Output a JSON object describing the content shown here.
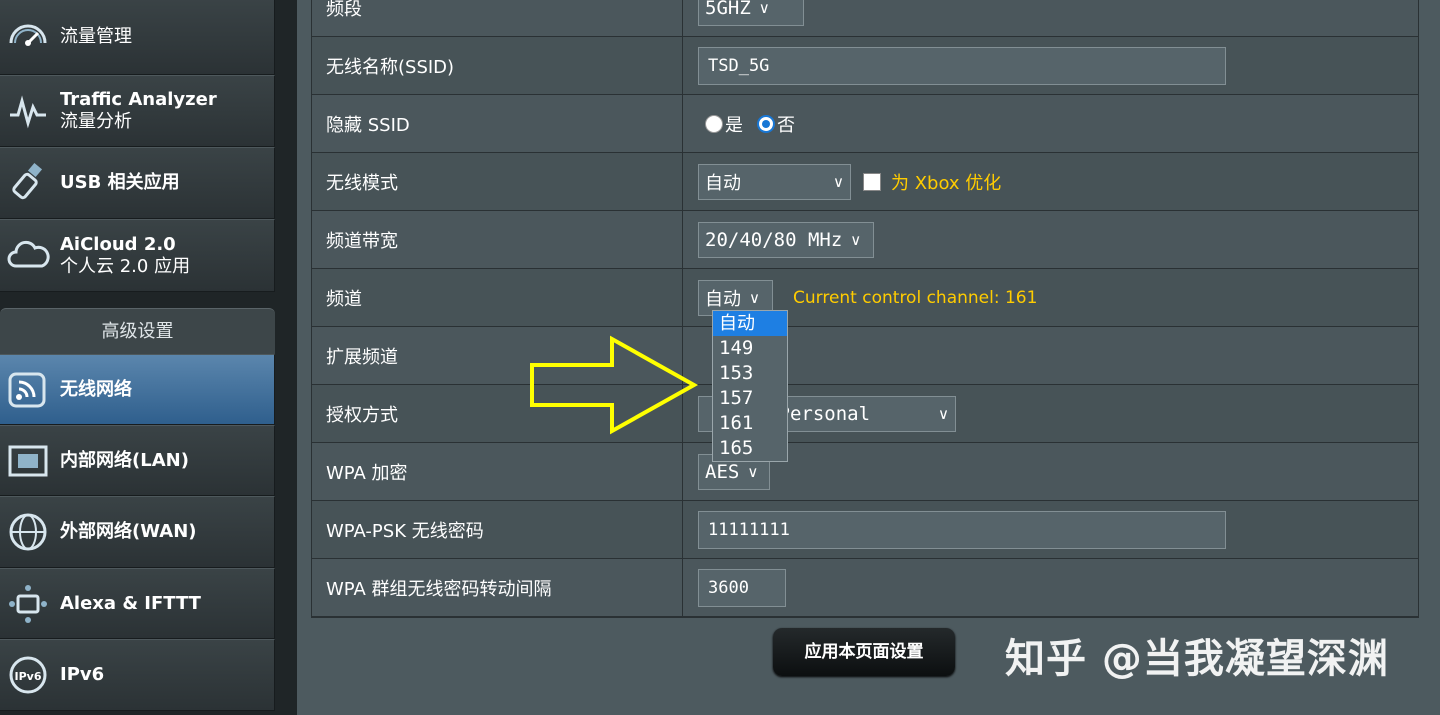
{
  "sidebar": {
    "top_items": [
      {
        "label": "流量管理",
        "sub": "",
        "icon": "gauge-icon"
      },
      {
        "label": "Traffic Analyzer",
        "sub": "流量分析",
        "icon": "pulse-icon"
      },
      {
        "label": "USB 相关应用",
        "sub": "",
        "icon": "usb-icon"
      },
      {
        "label": "AiCloud 2.0",
        "sub": "个人云 2.0 应用",
        "icon": "cloud-icon"
      }
    ],
    "advanced_header": "高级设置",
    "adv_items": [
      {
        "label": "无线网络",
        "icon": "wifi-icon",
        "active": true
      },
      {
        "label": "内部网络(LAN)",
        "icon": "lan-icon"
      },
      {
        "label": "外部网络(WAN)",
        "icon": "globe-icon"
      },
      {
        "label": "Alexa & IFTTT",
        "icon": "alexa-icon"
      },
      {
        "label": "IPv6",
        "icon": "ipv6-icon"
      }
    ]
  },
  "form": {
    "band": {
      "label": "频段",
      "value": "5GHZ"
    },
    "ssid": {
      "label": "无线名称(SSID)",
      "value": "TSD_5G"
    },
    "hide_ssid": {
      "label": "隐藏 SSID",
      "opt_yes": "是",
      "opt_no": "否",
      "selected": "否"
    },
    "wireless_mode": {
      "label": "无线模式",
      "value": "自动",
      "xbox_label": "为 Xbox 优化",
      "xbox_checked": false
    },
    "bandwidth": {
      "label": "频道带宽",
      "value": "20/40/80 MHz"
    },
    "channel": {
      "label": "频道",
      "value": "自动",
      "current_channel_text": "Current control channel: 161"
    },
    "ext_channel": {
      "label": "扩展频道"
    },
    "auth": {
      "label": "授权方式",
      "value": "Personal"
    },
    "wpa_encrypt": {
      "label": "WPA 加密",
      "value": "AES"
    },
    "wpa_psk": {
      "label": "WPA-PSK 无线密码",
      "value": "11111111"
    },
    "group_key": {
      "label": "WPA 群组无线密码转动间隔",
      "value": "3600"
    }
  },
  "channel_dropdown": {
    "options": [
      "自动",
      "149",
      "153",
      "157",
      "161",
      "165"
    ],
    "highlighted": "自动"
  },
  "apply_button": "应用本页面设置",
  "watermark": "知乎 @当我凝望深渊",
  "colors": {
    "accent": "#1e7fe3",
    "hint": "#ffcc00",
    "arrow": "#ffff00"
  }
}
